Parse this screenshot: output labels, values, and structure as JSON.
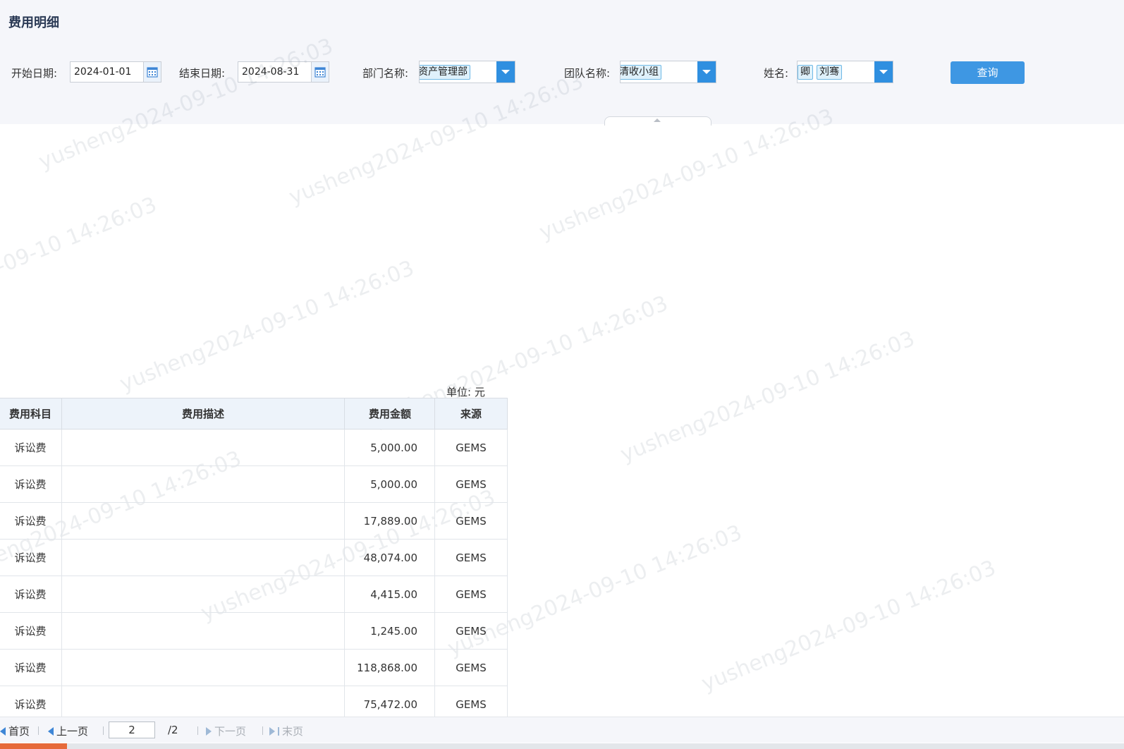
{
  "page": {
    "title": "费用明细"
  },
  "filters": {
    "start_label": "开始日期:",
    "start_value": "2024-01-01",
    "end_label": "结束日期:",
    "end_value": "2024-08-31",
    "dept_label": "部门名称:",
    "dept_tags": [
      "资产管理部"
    ],
    "team_label": "团队名称:",
    "team_tags": [
      "清收小组"
    ],
    "name_label": "姓名:",
    "name_tags": [
      "卿",
      "刘骞"
    ],
    "query_label": "查询"
  },
  "watermark_text": "yusheng2024-09-10 14:26:03",
  "table": {
    "unit_text": "单位: 元",
    "columns": [
      "费用科目",
      "费用描述",
      "费用金额",
      "来源"
    ],
    "rows": [
      [
        "诉讼费",
        "",
        "5,000.00",
        "GEMS"
      ],
      [
        "诉讼费",
        "",
        "5,000.00",
        "GEMS"
      ],
      [
        "诉讼费",
        "",
        "17,889.00",
        "GEMS"
      ],
      [
        "诉讼费",
        "",
        "48,074.00",
        "GEMS"
      ],
      [
        "诉讼费",
        "",
        "4,415.00",
        "GEMS"
      ],
      [
        "诉讼费",
        "",
        "1,245.00",
        "GEMS"
      ],
      [
        "诉讼费",
        "",
        "118,868.00",
        "GEMS"
      ],
      [
        "诉讼费",
        "",
        "75,472.00",
        "GEMS"
      ]
    ]
  },
  "pager": {
    "first": "首页",
    "prev": "上一页",
    "current_page": "2",
    "total": "/2",
    "next": "下一页",
    "last": "末页"
  },
  "colors": {
    "accent": "#3e97e3",
    "header_bg": "#f5f6fa",
    "tag_bg": "#dff1fb"
  }
}
